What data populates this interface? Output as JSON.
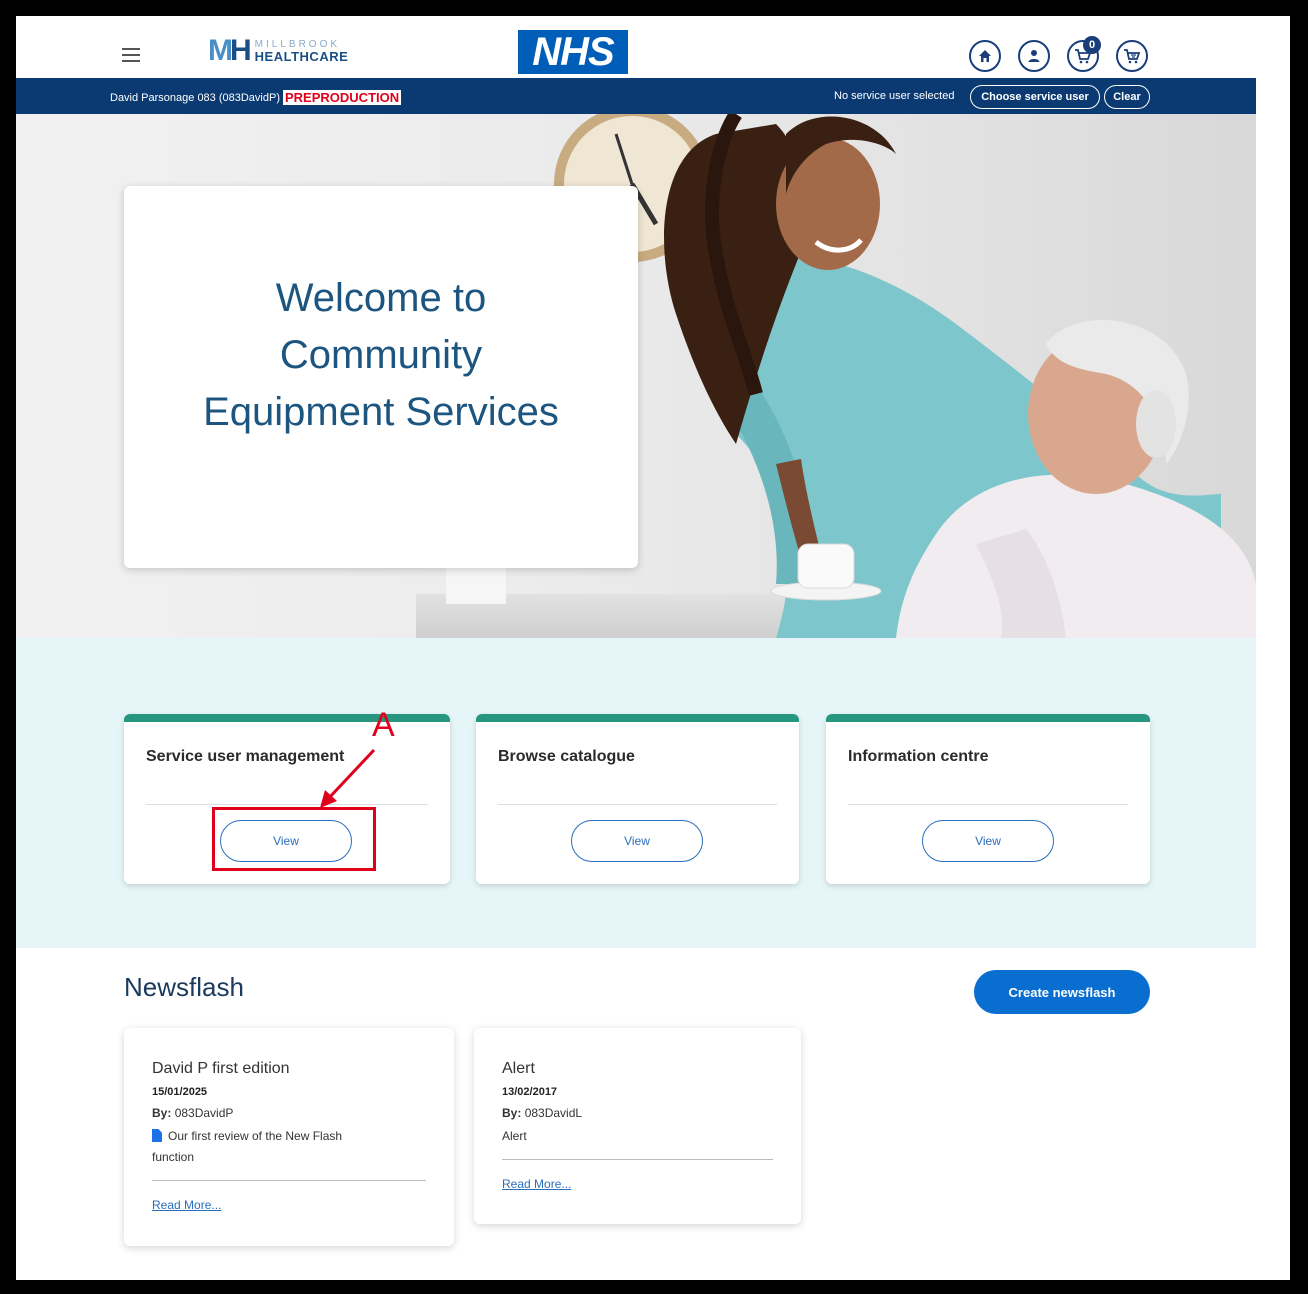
{
  "header": {
    "logo_top": "MILLBROOK",
    "logo_bottom": "HEALTHCARE",
    "logo_mh": "MH",
    "nhs": "NHS",
    "cart_count": "0",
    "icons": [
      "home-icon",
      "user-icon",
      "cart-icon",
      "basket-icon"
    ]
  },
  "status_bar": {
    "user": "David Parsonage 083 (083DavidP)",
    "environment": "PREPRODUCTION",
    "service_user_status": "No service user selected",
    "choose_label": "Choose service user",
    "clear_label": "Clear"
  },
  "hero": {
    "title_line1": "Welcome to",
    "title_line2": "Community",
    "title_line3": "Equipment Services"
  },
  "tiles": [
    {
      "title": "Service user management",
      "button": "View"
    },
    {
      "title": "Browse catalogue",
      "button": "View"
    },
    {
      "title": "Information centre",
      "button": "View"
    }
  ],
  "annotation": {
    "label": "A"
  },
  "newsflash": {
    "heading": "Newsflash",
    "create_label": "Create newsflash",
    "items": [
      {
        "title": "David P first edition",
        "date": "15/01/2025",
        "by_label": "By:",
        "author": "083DavidP",
        "body_line1": "Our first review of the New Flash",
        "body_line2": "function",
        "read_more": "Read More..."
      },
      {
        "title": "Alert",
        "date": "13/02/2017",
        "by_label": "By:",
        "author": "083DavidL",
        "body_line1": "Alert",
        "read_more": "Read More..."
      }
    ]
  },
  "colors": {
    "navy": "#0b3a73",
    "teal": "#27967f",
    "primary_blue": "#0a6ed1",
    "preproduction_red": "#e0001b",
    "tiles_background": "#e6f5f7"
  }
}
